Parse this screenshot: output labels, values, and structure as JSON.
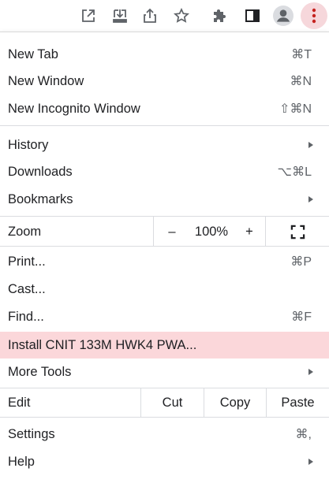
{
  "toolbar": {
    "icons": [
      "open-in-new-icon",
      "install-app-icon",
      "share-icon",
      "star-bookmark-icon",
      "extensions-icon",
      "side-panel-icon",
      "profile-icon",
      "more-vert-icon"
    ]
  },
  "menu": {
    "new_tab": {
      "label": "New Tab",
      "shortcut": "⌘T"
    },
    "new_window": {
      "label": "New Window",
      "shortcut": "⌘N"
    },
    "new_incognito": {
      "label": "New Incognito Window",
      "shortcut": "⇧⌘N"
    },
    "history": {
      "label": "History"
    },
    "downloads": {
      "label": "Downloads",
      "shortcut": "⌥⌘L"
    },
    "bookmarks": {
      "label": "Bookmarks"
    },
    "zoom": {
      "label": "Zoom",
      "minus": "–",
      "level": "100%",
      "plus": "+"
    },
    "print": {
      "label": "Print...",
      "shortcut": "⌘P"
    },
    "cast": {
      "label": "Cast..."
    },
    "find": {
      "label": "Find...",
      "shortcut": "⌘F"
    },
    "install": {
      "label": "Install CNIT 133M HWK4 PWA..."
    },
    "more_tools": {
      "label": "More Tools"
    },
    "edit": {
      "label": "Edit",
      "cut": "Cut",
      "copy": "Copy",
      "paste": "Paste"
    },
    "settings": {
      "label": "Settings",
      "shortcut": "⌘,"
    },
    "help": {
      "label": "Help"
    }
  },
  "colors": {
    "highlight": "#fbd7da",
    "menu_button_bg": "#f6d7db",
    "menu_dots": "#c5221f",
    "icon_gray": "#5f6368"
  }
}
